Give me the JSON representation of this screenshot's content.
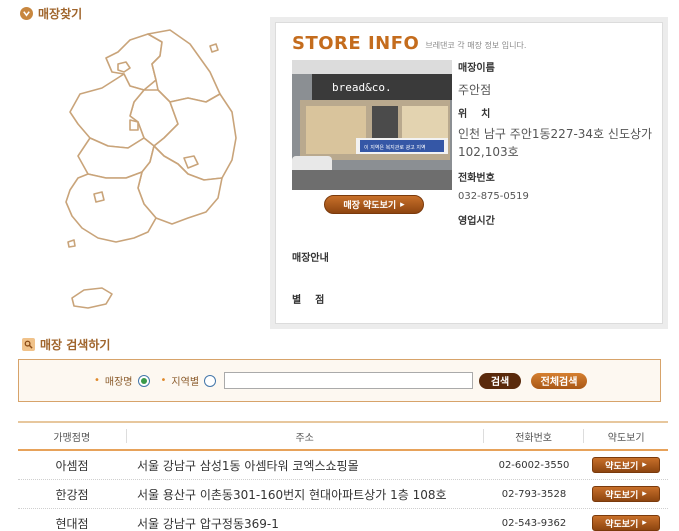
{
  "finder": {
    "title": "매장찾기"
  },
  "store_info": {
    "heading": "STORE INFO",
    "subheading": "브레댄코 각 매장 정보 입니다.",
    "photo_sign": "bread&co.",
    "photo_banner": "이 지역은 복지관로 광고 지역",
    "map_button": "매장 약도보기",
    "name_label": "매장이름",
    "name_value": "주안점",
    "location_label": "위    치",
    "location_value": "인천 남구 주안1동227-34호 신도상가 102,103호",
    "phone_label": "전화번호",
    "phone_value": "032-875-0519",
    "hours_label": "영업시간",
    "guide_label": "매장안내",
    "branch_label": "별    점"
  },
  "search": {
    "title": "매장 검색하기",
    "option_store": "매장명",
    "option_region": "지역별",
    "selected": "매장명",
    "query": "",
    "search_button": "검색",
    "all_button": "전체검색"
  },
  "table": {
    "headers": [
      "가맹점명",
      "주소",
      "전화번호",
      "약도보기"
    ],
    "map_button": "약도보기",
    "rows": [
      {
        "name": "아셈점",
        "address": "서울 강남구 삼성1동 아셈타워 코엑스쇼핑몰",
        "phone": "02-6002-3550"
      },
      {
        "name": "한강점",
        "address": "서울 용산구 이촌동301-160번지 현대아파트상가 1층 108호",
        "phone": "02-793-3528"
      },
      {
        "name": "현대점",
        "address": "서울 강남구 압구정동369-1",
        "phone": "02-543-9362"
      }
    ]
  },
  "colors": {
    "accent": "#c46c1d",
    "button_brown": "#8e4510",
    "search_border": "#d7a36a"
  }
}
